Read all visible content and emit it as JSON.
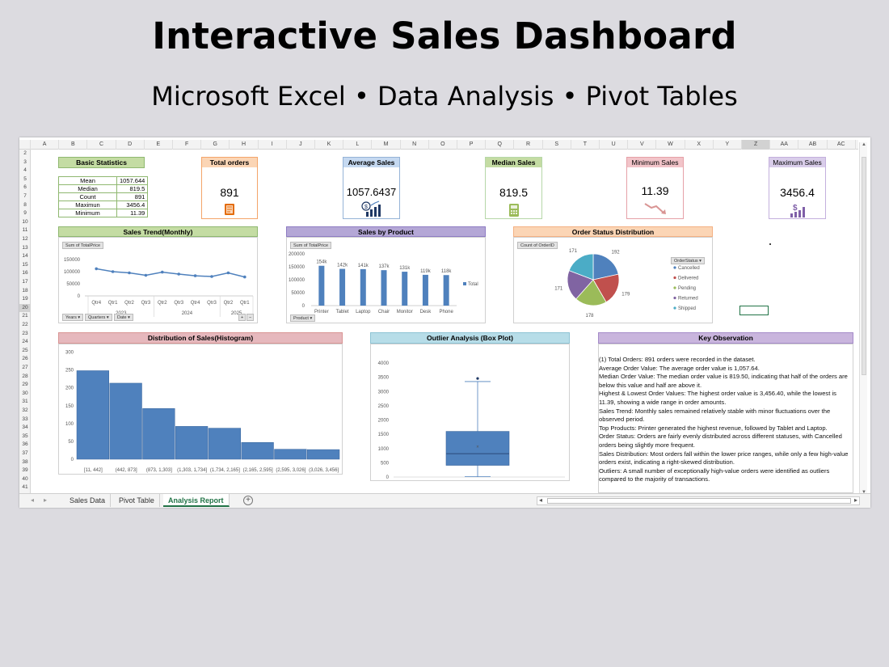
{
  "header": {
    "title": "Interactive Sales Dashboard",
    "subtitle": "Microsoft Excel • Data Analysis • Pivot Tables"
  },
  "sheet": {
    "columns": [
      "A",
      "B",
      "C",
      "D",
      "E",
      "F",
      "G",
      "H",
      "I",
      "J",
      "K",
      "L",
      "M",
      "N",
      "O",
      "P",
      "Q",
      "R",
      "S",
      "T",
      "U",
      "V",
      "W",
      "X",
      "Y",
      "Z",
      "AA",
      "AB",
      "AC"
    ],
    "selected_column": "Z",
    "rows": [
      "2",
      "3",
      "4",
      "5",
      "6",
      "7",
      "8",
      "9",
      "10",
      "11",
      "12",
      "13",
      "14",
      "15",
      "16",
      "17",
      "18",
      "19",
      "20",
      "21",
      "22",
      "23",
      "24",
      "25",
      "26",
      "27",
      "28",
      "29",
      "30",
      "31",
      "32",
      "33",
      "34",
      "35",
      "36",
      "37",
      "38",
      "39",
      "40",
      "41"
    ],
    "selected_row": "20"
  },
  "basic_stats": {
    "title": "Basic Statistics",
    "rows": [
      {
        "label": "Mean",
        "value": "1057.644"
      },
      {
        "label": "Median",
        "value": "819.5"
      },
      {
        "label": "Count",
        "value": "891"
      },
      {
        "label": "Maximun",
        "value": "3456.4"
      },
      {
        "label": "Minimum",
        "value": "11.39"
      }
    ]
  },
  "kpis": {
    "total_orders": {
      "title": "Total orders",
      "value": "891",
      "icon": "receipt-icon",
      "color": "#f4a56a"
    },
    "average_sales": {
      "title": "Average Sales",
      "value": "1057.6437",
      "icon": "coin-chart-icon",
      "color": "#95b3d7"
    },
    "median_sales": {
      "title": "Median Sales",
      "value": "819.5",
      "icon": "calculator-icon",
      "color": "#b6d7a8"
    },
    "minimum_sales": {
      "title": "Minimum Sales",
      "value": "11.39",
      "icon": "downtrend-icon",
      "color": "#e6a1a8"
    },
    "maximum_sales": {
      "title": "Maximum Sales",
      "value": "3456.4",
      "icon": "dollar-bars-icon",
      "color": "#c4b0dd"
    }
  },
  "sales_trend": {
    "title": "Sales Trend(Monthly)",
    "field_button": "Sum of TotalPrice",
    "filter_buttons": [
      "Years",
      "Quarters",
      "Date"
    ],
    "year_labels": [
      "2023",
      "2024",
      "2025"
    ]
  },
  "sales_by_product": {
    "title": "Sales by Product",
    "field_button": "Sum of TotalPrice",
    "filter_button": "Product",
    "legend": "Total"
  },
  "order_status": {
    "title": "Order Status Distribution",
    "field_button": "Count of OrderID",
    "legend_title": "OrderStatus"
  },
  "histogram": {
    "title": "Distribution of Sales(Histogram)"
  },
  "boxplot": {
    "title": "Outlier Analysis (Box Plot)"
  },
  "observations": {
    "title": "Key Observation",
    "lines": [
      "(1)   Total Orders: 891 orders were recorded in the dataset.",
      " Average Order Value: The average order value is 1,057.64.",
      "Median Order Value: The median order value is 819.50, indicating that half of the orders are below this value and half are above it.",
      "Highest & Lowest Order Values: The highest order value is 3,456.40, while the lowest is 11.39, showing a wide range in order amounts.",
      "Sales Trend: Monthly sales remained relatively stable with minor fluctuations over the observed period.",
      "Top Products: Printer generated the highest revenue, followed by Tablet and Laptop.",
      "Order Status: Orders are fairly evenly distributed across different statuses, with Cancelled orders being slightly more frequent.",
      "Sales Distribution: Most orders fall within the lower price ranges, while only a few high-value orders exist, indicating a right-skewed distribution.",
      "Outliers: A small number of exceptionally high-value orders were identified as outliers compared to the majority of transactions."
    ]
  },
  "tabs": [
    "Sales Data",
    "Pivot Table",
    "Analysis Report"
  ],
  "active_tab": "Analysis Report",
  "colors": {
    "bar": "#4f81bd",
    "excel_green": "#217346",
    "header_green": "#c4dca3",
    "header_purple": "#b4a7d6",
    "header_orange": "#fbd5b5",
    "header_pink": "#e6b8bd",
    "header_teal": "#b7dde8"
  },
  "chart_data": [
    {
      "type": "line",
      "title": "Sales Trend(Monthly)",
      "categories": [
        "Qtr4",
        "Qtr1",
        "Qtr2",
        "Qtr3",
        "Qtr2",
        "Qtr3",
        "Qtr4",
        "Qtr3",
        "Qtr2",
        "Qtr1"
      ],
      "values": [
        112000,
        100000,
        95000,
        85000,
        98000,
        90000,
        83000,
        80000,
        95000,
        78000
      ],
      "ylim": [
        0,
        150000
      ],
      "yticks": [
        0,
        50000,
        100000,
        150000
      ]
    },
    {
      "type": "bar",
      "title": "Sales by Product",
      "categories": [
        "Printer",
        "Tablet",
        "Laptop",
        "Chair",
        "Monitor",
        "Desk",
        "Phone"
      ],
      "values": [
        154000,
        142000,
        141000,
        137000,
        131000,
        119000,
        118000
      ],
      "labels": [
        "154k",
        "142k",
        "141k",
        "137k",
        "131k",
        "119k",
        "118k"
      ],
      "series": [
        {
          "name": "Total",
          "values": [
            154000,
            142000,
            141000,
            137000,
            131000,
            119000,
            118000
          ]
        }
      ],
      "ylim": [
        0,
        200000
      ],
      "yticks": [
        0,
        50000,
        100000,
        150000,
        200000
      ]
    },
    {
      "type": "pie",
      "title": "Order Status Distribution",
      "categories": [
        "Cancelled",
        "Delivered",
        "Pending",
        "Returned",
        "Shipped"
      ],
      "values": [
        192,
        179,
        178,
        171,
        171
      ],
      "colors": [
        "#4f81bd",
        "#c0504d",
        "#9bbb59",
        "#8064a2",
        "#4bacc6"
      ]
    },
    {
      "type": "bar",
      "title": "Distribution of Sales(Histogram)",
      "categories": [
        "[11, 442]",
        "(442, 873]",
        "(873, 1,303]",
        "(1,303, 1,734]",
        "(1,734, 2,165]",
        "(2,165, 2,595]",
        "(2,595, 3,026]",
        "(3,026, 3,456]"
      ],
      "values": [
        248,
        213,
        142,
        92,
        87,
        47,
        28,
        27
      ],
      "ylim": [
        0,
        300
      ],
      "yticks": [
        0,
        50,
        100,
        150,
        200,
        250,
        300
      ]
    },
    {
      "type": "boxplot",
      "title": "Outlier Analysis (Box Plot)",
      "categories": [
        "1"
      ],
      "min": 11.39,
      "q1": 410,
      "median": 819.5,
      "mean": 1057.64,
      "q3": 1600,
      "whisker_high": 3350,
      "outliers": [
        3456.4
      ],
      "ylim": [
        0,
        4000
      ],
      "yticks": [
        0,
        500,
        1000,
        1500,
        2000,
        2500,
        3000,
        3500,
        4000
      ]
    }
  ]
}
